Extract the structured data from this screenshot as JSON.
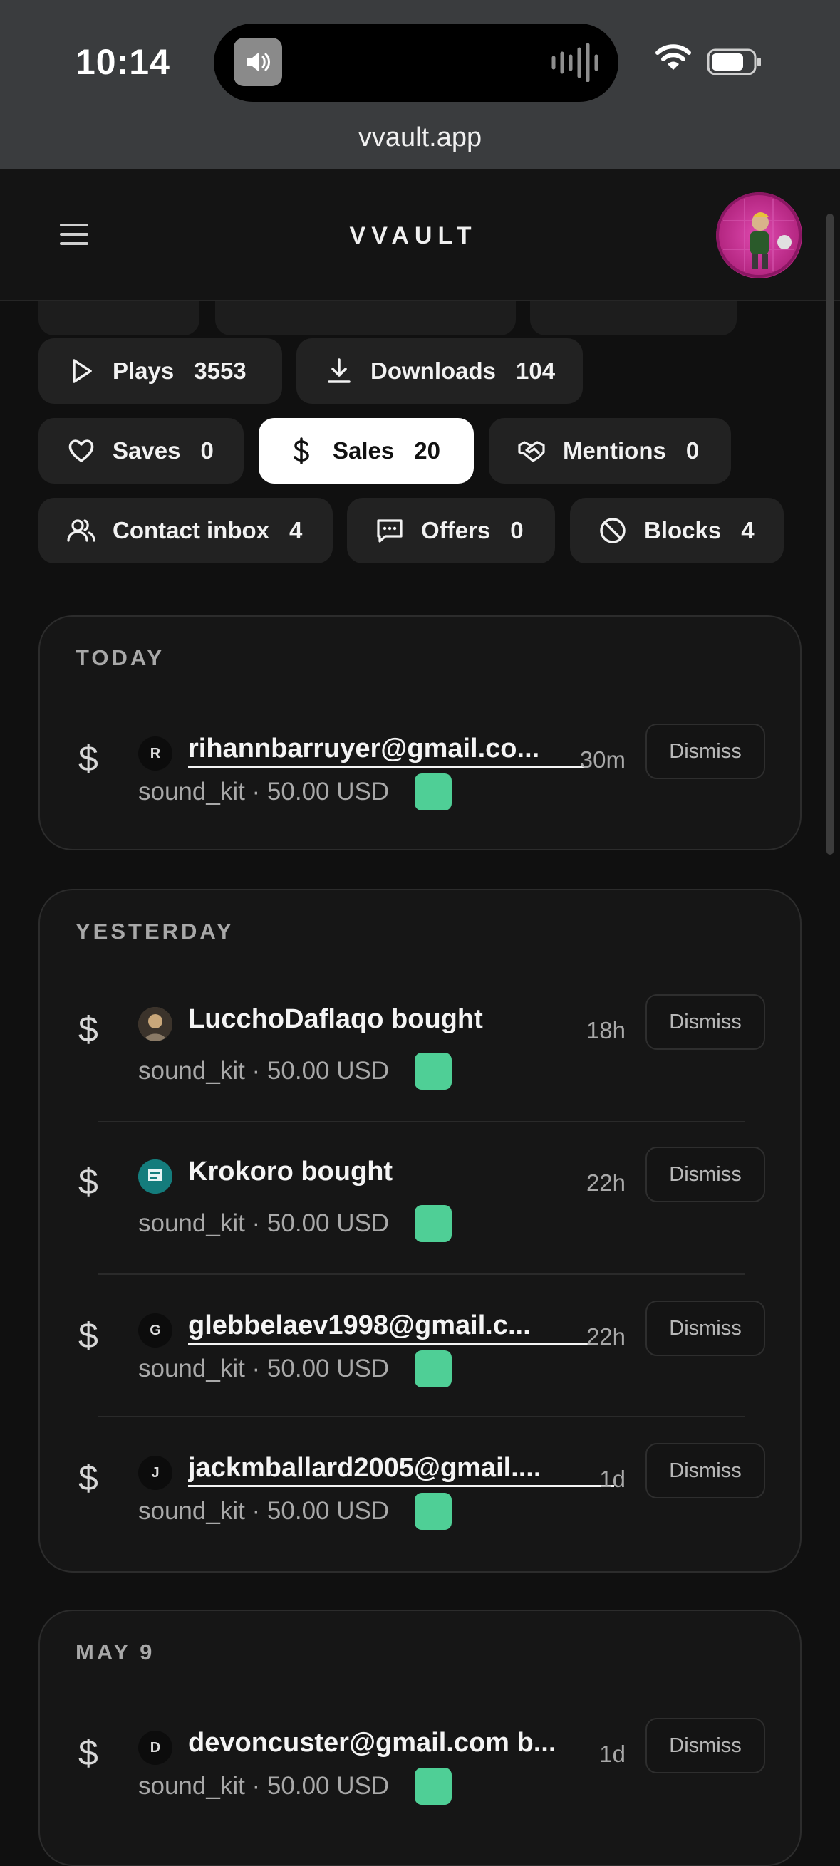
{
  "status": {
    "time": "10:14"
  },
  "browser": {
    "url": "vvault.app"
  },
  "header": {
    "logo": "VVAULT"
  },
  "chips": [
    {
      "key": "plays",
      "label": "Plays",
      "count": "3553",
      "icon": "play-icon",
      "active": false
    },
    {
      "key": "downloads",
      "label": "Downloads",
      "count": "104",
      "icon": "download-icon",
      "active": false
    },
    {
      "key": "saves",
      "label": "Saves",
      "count": "0",
      "icon": "heart-icon",
      "active": false
    },
    {
      "key": "sales",
      "label": "Sales",
      "count": "20",
      "icon": "dollar-icon",
      "active": true
    },
    {
      "key": "mentions",
      "label": "Mentions",
      "count": "0",
      "icon": "handshake-icon",
      "active": false
    },
    {
      "key": "contact",
      "label": "Contact inbox",
      "count": "4",
      "icon": "users-icon",
      "active": false
    },
    {
      "key": "offers",
      "label": "Offers",
      "count": "0",
      "icon": "message-icon",
      "active": false
    },
    {
      "key": "blocks",
      "label": "Blocks",
      "count": "4",
      "icon": "block-icon",
      "active": false
    }
  ],
  "groups": [
    {
      "title": "TODAY",
      "items": [
        {
          "initial": "R",
          "name": "rihannbarruyer@gmail.co...",
          "sub": "sound_kit · 50.00 USD",
          "ago": "30m",
          "dismiss": "Dismiss"
        }
      ]
    },
    {
      "title": "YESTERDAY",
      "items": [
        {
          "initial": "",
          "name": "LucchoDaflaqo bought",
          "sub": "sound_kit · 50.00 USD",
          "ago": "18h",
          "dismiss": "Dismiss"
        },
        {
          "initial": "",
          "name": "Krokoro bought",
          "sub": "sound_kit · 50.00 USD",
          "ago": "22h",
          "dismiss": "Dismiss"
        },
        {
          "initial": "G",
          "name": "glebbelaev1998@gmail.c...",
          "sub": "sound_kit · 50.00 USD",
          "ago": "22h",
          "dismiss": "Dismiss"
        },
        {
          "initial": "J",
          "name": "jackmballard2005@gmail....",
          "sub": "sound_kit · 50.00 USD",
          "ago": "1d",
          "dismiss": "Dismiss"
        }
      ]
    },
    {
      "title": "MAY 9",
      "items": [
        {
          "initial": "D",
          "name": "devoncuster@gmail.com",
          "name_suffix": " b...",
          "sub": "sound_kit · 50.00 USD",
          "ago": "1d",
          "dismiss": "Dismiss"
        }
      ]
    }
  ],
  "colors": {
    "swatch": "#4fcf96",
    "background": "#101010",
    "chip": "#222222",
    "active_chip": "#ffffff"
  }
}
